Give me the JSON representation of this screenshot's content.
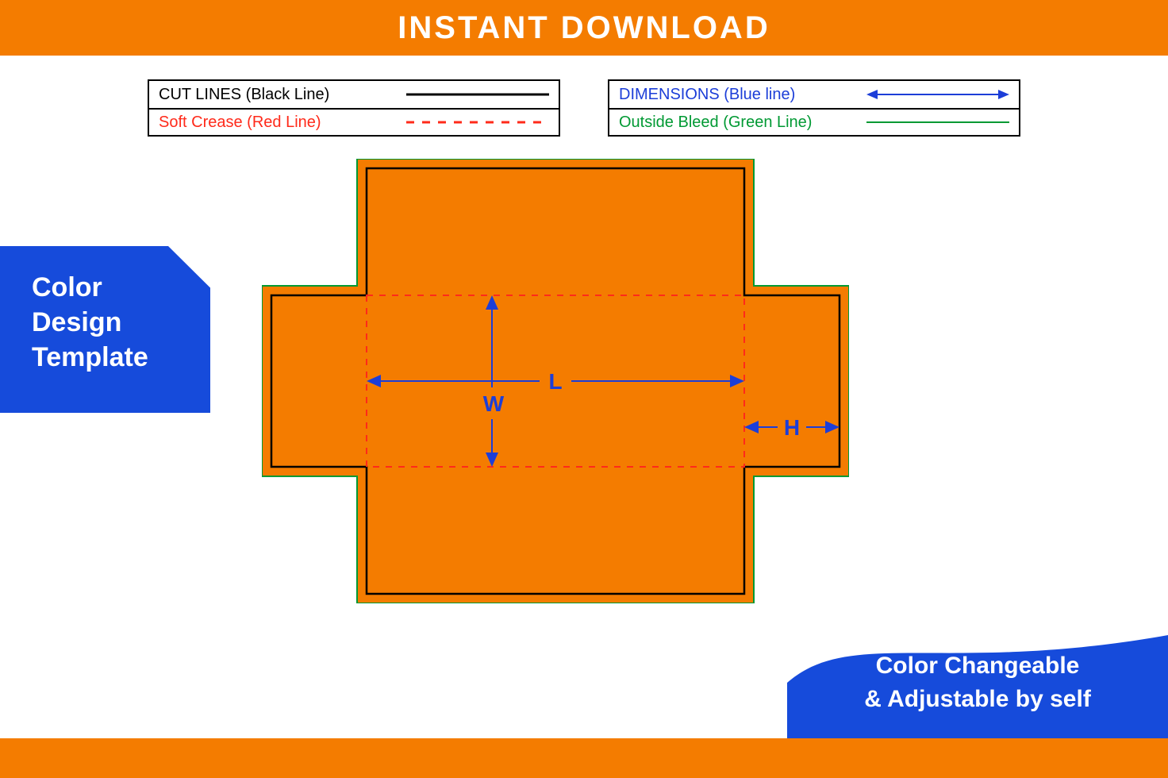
{
  "header": {
    "title": "INSTANT DOWNLOAD"
  },
  "legend": {
    "left": [
      {
        "label": "CUT LINES (Black Line)",
        "colorClass": "black",
        "style": "cut"
      },
      {
        "label": "Soft Crease (Red Line)",
        "colorClass": "red",
        "style": "crease"
      }
    ],
    "right": [
      {
        "label": "DIMENSIONS (Blue line)",
        "colorClass": "blue",
        "style": "dimension"
      },
      {
        "label": "Outside Bleed (Green Line)",
        "colorClass": "green",
        "style": "bleed"
      }
    ]
  },
  "badges": {
    "left": "Color\nDesign\nTemplate",
    "right": "Color Changeable\n& Adjustable by self"
  },
  "dieline": {
    "dimension_labels": {
      "L": "L",
      "W": "W",
      "H": "H"
    }
  },
  "colors": {
    "orange": "#f47c00",
    "blue": "#1c3ed8",
    "badgeBlue": "#164bdb",
    "red": "#ff2a1a",
    "green": "#009933",
    "black": "#000000"
  }
}
